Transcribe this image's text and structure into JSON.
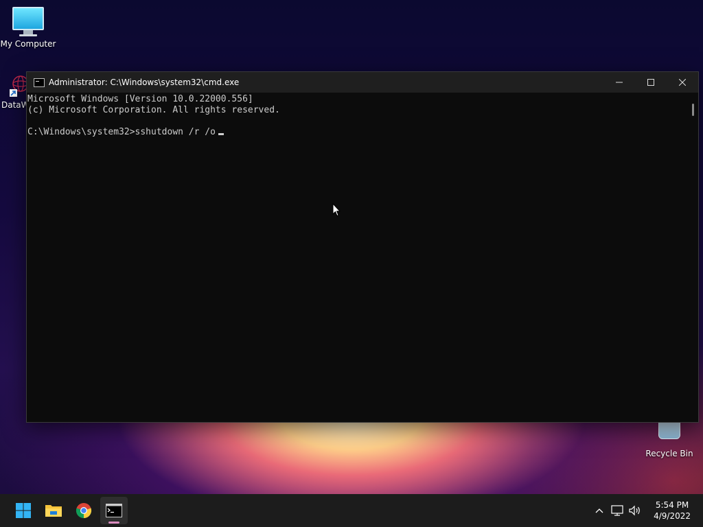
{
  "desktop": {
    "icons": [
      {
        "label": "My Computer"
      },
      {
        "label": "DataW"
      },
      {
        "label": "Recycle Bin"
      }
    ]
  },
  "window": {
    "title": "Administrator: C:\\Windows\\system32\\cmd.exe",
    "controls": {
      "minimize": "—",
      "maximize": "☐",
      "close": "✕"
    }
  },
  "console": {
    "lines": [
      "Microsoft Windows [Version 10.0.22000.556]",
      "(c) Microsoft Corporation. All rights reserved.",
      "",
      "C:\\Windows\\system32>sshutdown /r /o"
    ]
  },
  "taskbar": {
    "apps": [
      {
        "name": "start-button",
        "icon": "windows-logo"
      },
      {
        "name": "file-explorer",
        "icon": "folder-icon"
      },
      {
        "name": "chrome",
        "icon": "chrome-icon"
      },
      {
        "name": "command-prompt",
        "icon": "terminal-icon",
        "active": true
      }
    ],
    "tray": {
      "time": "5:54 PM",
      "date": "4/9/2022"
    }
  },
  "colors": {
    "console_bg": "#0c0c0c",
    "console_text": "#cccccc",
    "titlebar": "#1f1f1f",
    "taskbar": "#1c1c1c",
    "active_indicator": "#d98bbf"
  }
}
